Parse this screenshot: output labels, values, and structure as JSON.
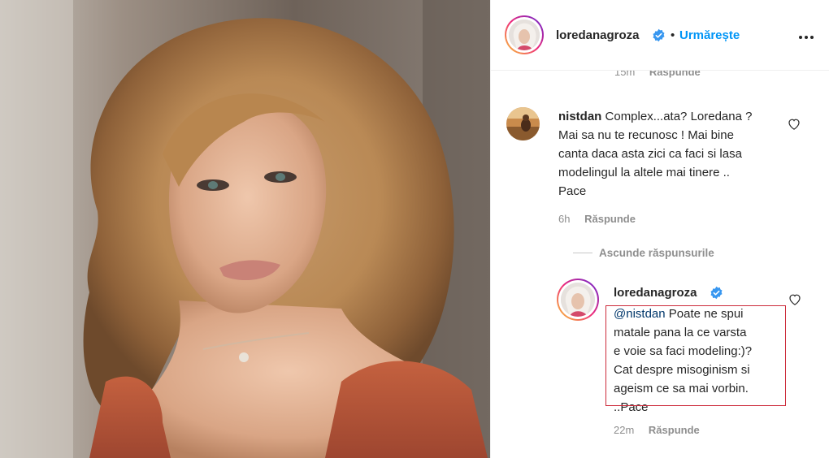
{
  "post": {
    "username": "loredanagroza",
    "follow_label": "Urmărește",
    "more_icon": "more-horizontal-icon"
  },
  "comments": {
    "top_partial": {
      "time": "15m",
      "reply_label": "Răspunde"
    },
    "first": {
      "username": "nistdan",
      "text": "Complex...ata? Loredana ? Mai sa nu te recunosc ! Mai bine canta daca asta zici ca faci si lasa modelingul la altele mai tinere .. Pace",
      "lines": [
        "Complex...ata? Loredana ?",
        "Mai sa nu te recunosc ! Mai bine",
        "canta daca asta zici ca faci si lasa",
        "modelingul la altele mai tinere ..",
        "Pace"
      ],
      "time": "6h",
      "reply_label": "Răspunde"
    },
    "hide_replies_label": "Ascunde răspunsurile",
    "reply": {
      "username": "loredanagroza",
      "mention": "@nistdan",
      "lines": [
        "Poate ne spui",
        "matale pana la ce varsta",
        "e voie sa faci modeling:)?",
        "Cat despre misoginism si",
        "ageism ce sa mai vorbin.",
        "..Pace"
      ],
      "time": "22m",
      "reply_label": "Răspunde"
    }
  },
  "colors": {
    "link_blue": "#0095f6",
    "mention_blue": "#00376b",
    "highlight_red": "#cc2a3a",
    "muted": "#8e8e8e"
  }
}
